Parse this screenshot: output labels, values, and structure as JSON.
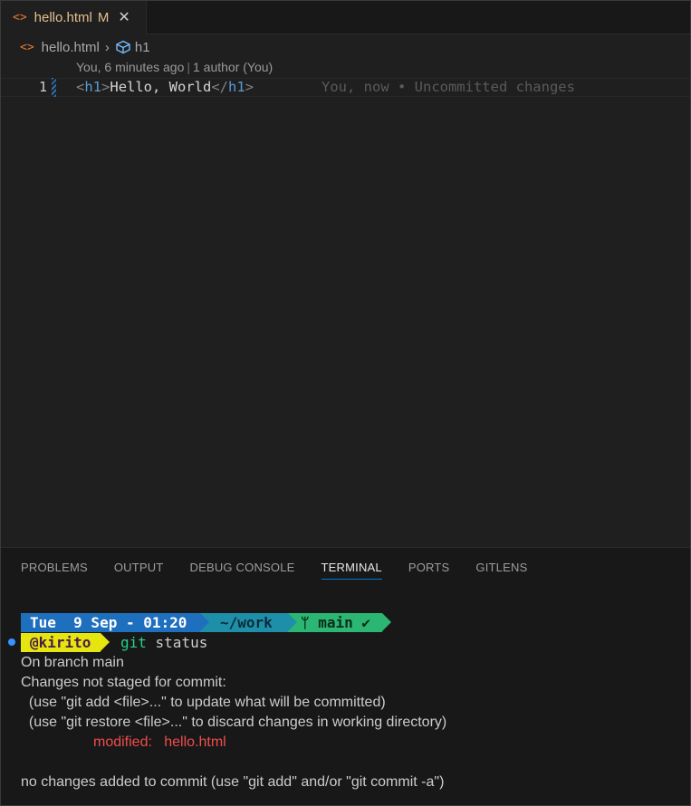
{
  "tab": {
    "file_icon": "<>",
    "name": "hello.html",
    "status": "M",
    "close": "✕"
  },
  "breadcrumb": {
    "file": "hello.html",
    "separator": "›",
    "symbol": "h1"
  },
  "editor": {
    "codelens": {
      "author_time": "You, 6 minutes ago",
      "authors": "1 author (You)"
    },
    "line_number": "1",
    "code": {
      "open_lt": "<",
      "open_tag": "h1",
      "open_gt": ">",
      "text": "Hello, World",
      "close_lt": "</",
      "close_tag": "h1",
      "close_gt": ">"
    },
    "inline_blame": "You, now • Uncommitted changes"
  },
  "panel": {
    "tabs": [
      {
        "label": "PROBLEMS"
      },
      {
        "label": "OUTPUT"
      },
      {
        "label": "DEBUG CONSOLE"
      },
      {
        "label": "TERMINAL",
        "active": true
      },
      {
        "label": "PORTS"
      },
      {
        "label": "GITLENS"
      }
    ]
  },
  "terminal": {
    "prompt": {
      "date": "Tue  9 Sep - 01:20",
      "dir": "~/work",
      "branch": "main",
      "branch_icon": "branch-icon",
      "check": "✔",
      "user": "@kirito"
    },
    "command": {
      "program": "git",
      "args": " status"
    },
    "output": {
      "l1": "On branch main",
      "l2": "Changes not staged for commit:",
      "l3": "  (use \"git add <file>...\" to update what will be committed)",
      "l4": "  (use \"git restore <file>...\" to discard changes in working directory)",
      "l5": "modified:   hello.html",
      "l6": "no changes added to commit (use \"git add\" and/or \"git commit -a\")"
    }
  },
  "colors": {
    "accent": "#0078d4",
    "modified": "#e2c08d",
    "tag": "#569cd6",
    "date_seg": "#1f6fbf",
    "dir_seg": "#1e8fa8",
    "branch_seg": "#2bb673",
    "user_seg": "#e5e510",
    "error_red": "#f14c4c"
  }
}
